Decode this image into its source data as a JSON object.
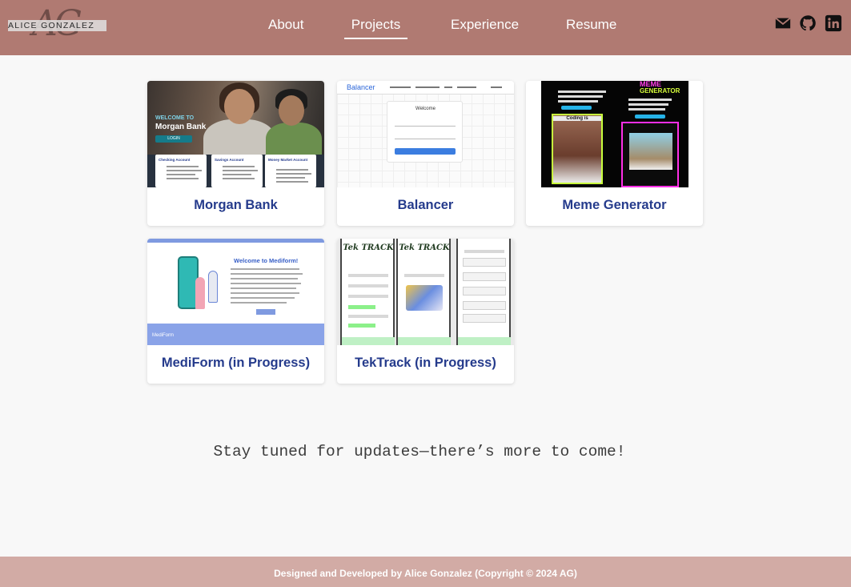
{
  "header": {
    "logo_text": "ALICE GONZALEZ",
    "logo_monogram": "AG",
    "nav": [
      {
        "label": "About"
      },
      {
        "label": "Projects",
        "active": true
      },
      {
        "label": "Experience"
      },
      {
        "label": "Resume"
      }
    ],
    "social": [
      "envelope-icon",
      "github-icon",
      "linkedin-icon"
    ]
  },
  "projects": [
    {
      "title": "Morgan Bank",
      "thumb": {
        "welcome": "WELCOME TO",
        "brand": "Morgan Bank",
        "login": "LOGIN",
        "boxes": [
          "Checking Account",
          "Savings Account",
          "Money Market Account"
        ]
      }
    },
    {
      "title": "Balancer",
      "thumb": {
        "brand": "Balancer",
        "panel_title": "Welcome"
      }
    },
    {
      "title": "Meme Generator",
      "thumb": {
        "title_top": "MEME",
        "title_bottom": "GENERATOR",
        "caption": "Coding is"
      }
    },
    {
      "title": "MediForm (in Progress)",
      "thumb": {
        "welcome": "Welcome to Mediform!",
        "footer_brand": "MediForm"
      }
    },
    {
      "title": "TekTrack (in Progress)",
      "thumb": {
        "logo": "Tek TRACK"
      }
    }
  ],
  "message": "Stay tuned for updates—there’s more to come!",
  "footer": {
    "text": "Designed and Developed by Alice Gonzalez (Copyright © 2024 AG)"
  },
  "colors": {
    "header_bg": "#b07a72",
    "footer_bg": "#d2aba5",
    "card_title": "#253b8c",
    "page_bg": "#f8f8f8"
  }
}
